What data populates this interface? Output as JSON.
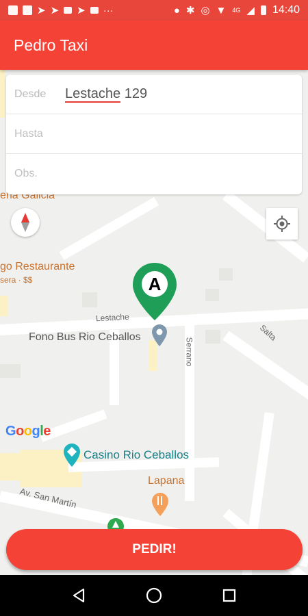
{
  "status_bar": {
    "network": "4G",
    "time": "14:40",
    "icons": [
      "notification-icon",
      "app-u-icon",
      "send-icon",
      "send-icon",
      "document-icon",
      "send-icon",
      "gmail-icon",
      "more-icon",
      "location-icon",
      "bluetooth-icon",
      "data-saver-icon",
      "wifi-icon",
      "signal-icon",
      "battery-icon"
    ]
  },
  "app_bar": {
    "title": "Pedro Taxi"
  },
  "form": {
    "from_label": "Desde",
    "from_value_street": "Lestache",
    "from_value_number": "129",
    "to_placeholder": "Hasta",
    "obs_placeholder": "Obs."
  },
  "map": {
    "labels": {
      "galicia": "eria Galicia",
      "restaurant": "go Restaurante",
      "restaurant_sub": "sera · $$",
      "street_lestache": "Lestache",
      "fono_bus": "Fono Bus Rio Ceballos",
      "serrano": "Serrano",
      "salta": "Salta",
      "casino": "Casino Rio Ceballos",
      "lapana": "Lapana",
      "san_martin": "Av. San Martín"
    },
    "marker_letter": "A",
    "logo": "Google",
    "colors": {
      "marker": "#1e9e57",
      "road": "#ffffff",
      "background": "#f0f0ee"
    }
  },
  "actions": {
    "request_label": "PEDIR!"
  },
  "colors": {
    "primary": "#f44336",
    "status_bar": "#e8463a"
  }
}
